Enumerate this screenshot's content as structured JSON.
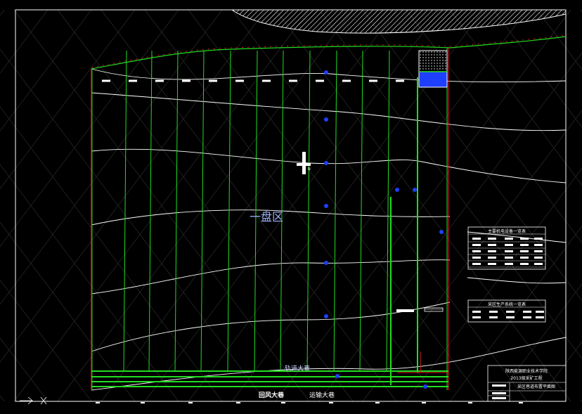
{
  "colors": {
    "background": "#000000",
    "frame": "#ffffff",
    "panel_lines": "#22dd22",
    "boundary": "#e11d1d",
    "contours": "#ffffff",
    "markers": "#1f3fff",
    "label_main": "#9db3ff",
    "label_road": "#ffffff",
    "label_rail": "#cfd6ff"
  },
  "labels": {
    "panel_area": "一盘区",
    "rail_roadway": "轨道大巷",
    "return_air_roadway": "回风大巷",
    "transport_roadway": "运输大巷"
  },
  "tables": {
    "equipment_title": "主要机电设备一览表",
    "production_title": "采区生产系统一览表"
  },
  "title_block": {
    "institution": "陕西能源职业技术学院",
    "course": "2013级采矿工程",
    "drawing_name": "采区巷道布置平面图"
  }
}
